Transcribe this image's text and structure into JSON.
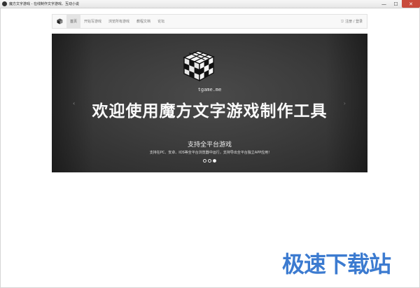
{
  "window": {
    "title": "魔方文字游戏 - 在线制作文字游戏、互动小说",
    "controls": {
      "minimize": "—",
      "maximize": "☐",
      "close": "✕"
    }
  },
  "navbar": {
    "brand_icon": "cube-icon",
    "items": [
      {
        "label": "首页",
        "active": true
      },
      {
        "label": "开始写游戏",
        "active": false
      },
      {
        "label": "浏览所有游戏",
        "active": false
      },
      {
        "label": "教程文档",
        "active": false
      },
      {
        "label": "论坛",
        "active": false
      }
    ],
    "login_icon": "login-icon",
    "login_label": "注册 / 登录"
  },
  "carousel": {
    "logo_text": "tgame.me",
    "headline": "欢迎使用魔方文字游戏制作工具",
    "subtitle": "支持全平台游戏",
    "description": "支持在PC、安卓、IOS等全平台浏览器中运行，支持导出全平台独立APP应用!",
    "prev_control": "‹",
    "next_control": "›",
    "indicator_count": 3,
    "active_indicator": 3
  },
  "watermark": {
    "text": "极速下载站"
  },
  "colors": {
    "carousel_bg": "#3d3d3d",
    "close_button": "#c84b3c",
    "watermark": "#3c7bd0"
  }
}
